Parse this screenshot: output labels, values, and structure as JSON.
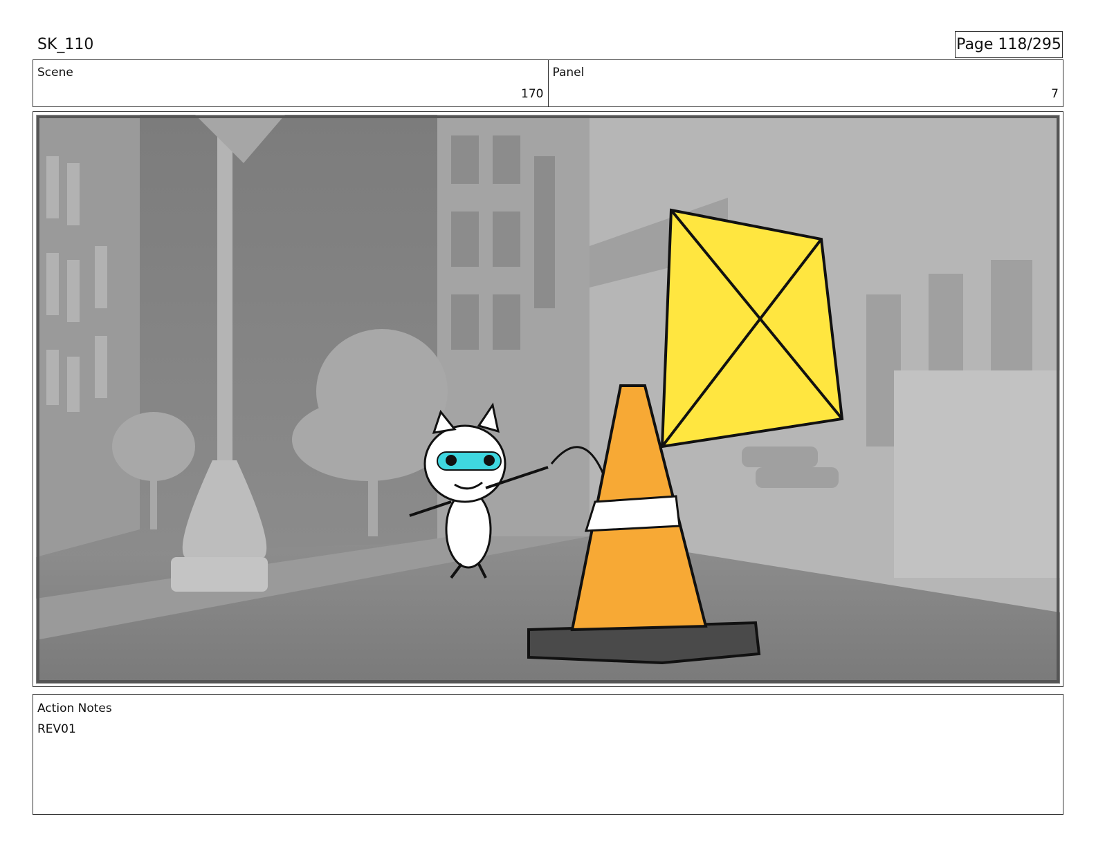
{
  "document": {
    "title": "SK_110",
    "page": "Page 118/295"
  },
  "info": {
    "scene_label": "Scene",
    "scene_value": "170",
    "panel_label": "Panel",
    "panel_value": "7"
  },
  "panel_image": {
    "description_icon": "storyboard-frame-image",
    "colors": {
      "kite": "#ffe640",
      "cone": "#f7a935",
      "cone_base": "#4a4a4a",
      "mask": "#3fd7e0",
      "background": "#8a8a8a"
    }
  },
  "notes": {
    "label": "Action Notes",
    "text": "REV01"
  }
}
